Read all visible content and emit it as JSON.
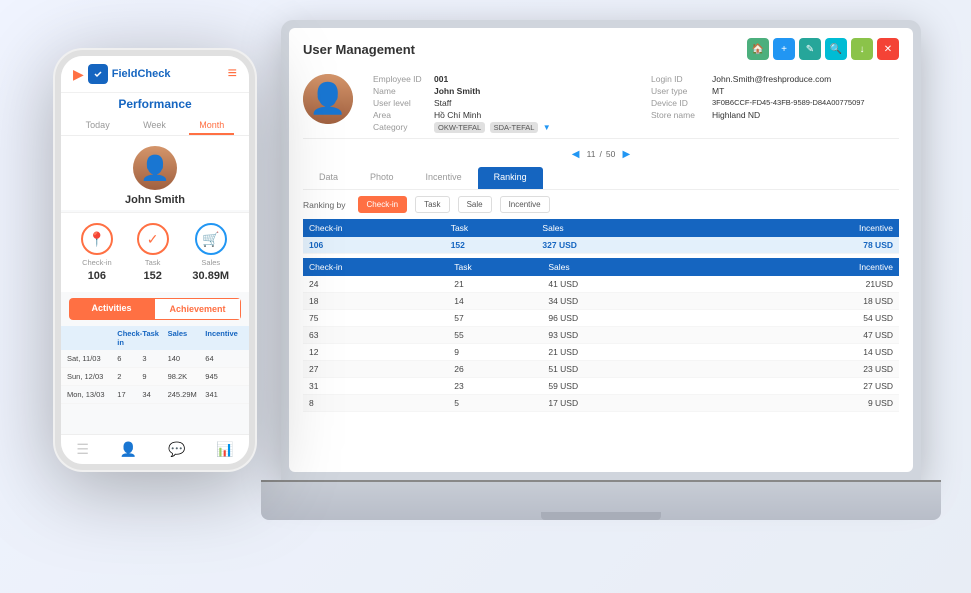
{
  "app": {
    "title": "FieldCheck"
  },
  "laptop": {
    "title": "User Management",
    "action_buttons": [
      {
        "label": "🏠",
        "color": "btn-green",
        "name": "home-btn"
      },
      {
        "label": "+",
        "color": "btn-blue-add",
        "name": "add-btn"
      },
      {
        "label": "✎",
        "color": "btn-teal",
        "name": "edit-btn"
      },
      {
        "label": "🔍",
        "color": "btn-cyan",
        "name": "search-btn"
      },
      {
        "label": "↓",
        "color": "btn-lime",
        "name": "export-btn"
      },
      {
        "label": "✕",
        "color": "btn-red",
        "name": "delete-btn"
      }
    ],
    "user": {
      "employee_id": "001",
      "name": "John Smith",
      "user_level": "Staff",
      "area": "Hồ Chí Minh",
      "category_tags": [
        "OKW-TEFAL",
        "SDA-TEFAL"
      ],
      "login_id": "John.Smith@freshproduce.com",
      "user_type": "MT",
      "device_id": "3F0B6CCF-FD45-43FB-9589-D84A00775097",
      "store_name": "Highland ND"
    },
    "pagination": {
      "current": "11",
      "total": "50",
      "prev": "◀",
      "next": "▶"
    },
    "tabs": [
      {
        "label": "Data",
        "active": false
      },
      {
        "label": "Photo",
        "active": false
      },
      {
        "label": "Incentive",
        "active": false
      },
      {
        "label": "Ranking",
        "active": true
      }
    ],
    "ranking": {
      "label": "Ranking by",
      "buttons": [
        {
          "label": "Check-in",
          "active": true
        },
        {
          "label": "Task",
          "active": false
        },
        {
          "label": "Sale",
          "active": false
        },
        {
          "label": "Incentive",
          "active": false
        }
      ]
    },
    "summary_table": {
      "headers": [
        "Check-in",
        "Task",
        "Sales",
        "",
        "",
        "Incentive"
      ],
      "row": [
        "106",
        "152",
        "327 USD",
        "",
        "",
        "78 USD"
      ]
    },
    "detail_table": {
      "headers": [
        "Check-in",
        "Task",
        "Sales",
        "",
        "",
        "Incentive"
      ],
      "rows": [
        [
          "24",
          "21",
          "41 USD",
          "",
          "",
          "21USD"
        ],
        [
          "18",
          "14",
          "34 USD",
          "",
          "",
          "18 USD"
        ],
        [
          "75",
          "57",
          "96 USD",
          "",
          "",
          "54 USD"
        ],
        [
          "63",
          "55",
          "93 USD",
          "",
          "",
          "47 USD"
        ],
        [
          "12",
          "9",
          "21 USD",
          "",
          "",
          "14 USD"
        ],
        [
          "27",
          "26",
          "51 USD",
          "",
          "",
          "23 USD"
        ],
        [
          "31",
          "23",
          "59 USD",
          "",
          "",
          "27 USD"
        ],
        [
          "8",
          "5",
          "17 USD",
          "",
          "",
          "9 USD"
        ]
      ]
    }
  },
  "phone": {
    "logo_text": "FieldCheck",
    "screen_title": "Performance",
    "tabs": [
      {
        "label": "Today",
        "active": false
      },
      {
        "label": "Week",
        "active": false
      },
      {
        "label": "Month",
        "active": true
      }
    ],
    "user_name": "John Smith",
    "stats": [
      {
        "icon": "📍",
        "label": "Check-in",
        "value": "106",
        "border": "orange"
      },
      {
        "icon": "✓",
        "label": "Task",
        "value": "152",
        "border": "orange"
      },
      {
        "icon": "🛒",
        "label": "Sales",
        "value": "30.89M",
        "border": "orange"
      }
    ],
    "activity_buttons": [
      {
        "label": "Activities",
        "active": true
      },
      {
        "label": "Achievement",
        "active": false
      }
    ],
    "table": {
      "headers": [
        "",
        "Check-in",
        "Task",
        "Sales",
        "Incentive"
      ],
      "rows": [
        [
          "Sat, 11/03",
          "6",
          "3",
          "140",
          "64"
        ],
        [
          "Sun, 12/03",
          "2",
          "9",
          "98.2K",
          "945"
        ],
        [
          "Mon, 13/03",
          "17",
          "34",
          "245.29M",
          "341"
        ]
      ]
    },
    "bottom_nav": [
      {
        "icon": "☰",
        "label": "list",
        "active": false
      },
      {
        "icon": "👤",
        "label": "profile",
        "active": false
      },
      {
        "icon": "💬",
        "label": "chat",
        "active": false
      },
      {
        "icon": "📊",
        "label": "stats",
        "active": true
      }
    ]
  }
}
